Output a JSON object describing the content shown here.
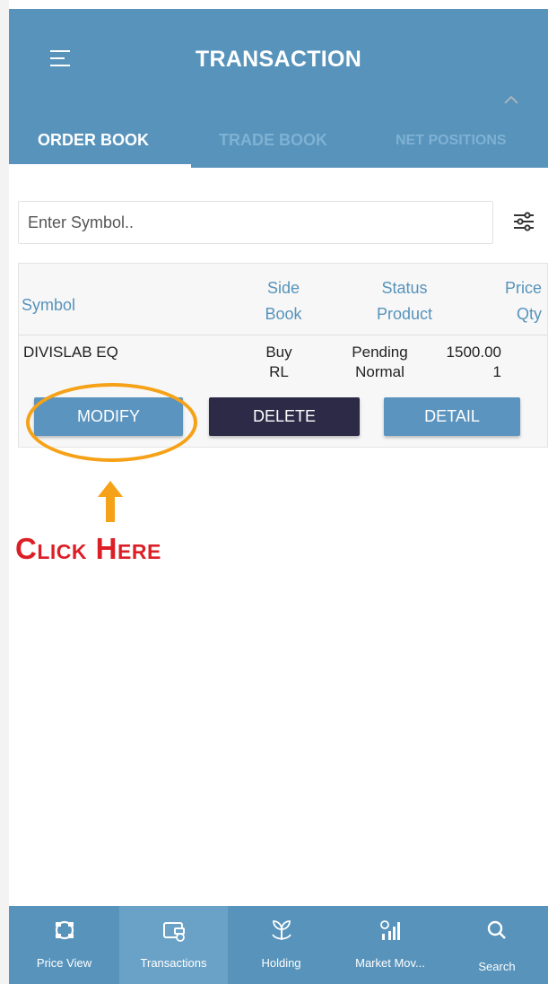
{
  "app_bar": {
    "title": "TRANSACTION",
    "tabs": [
      {
        "label": "ORDER BOOK",
        "active": true
      },
      {
        "label": "TRADE BOOK",
        "active": false
      },
      {
        "label": "NET POSITIONS",
        "active": false
      }
    ]
  },
  "search": {
    "placeholder": "Enter Symbol..",
    "value": ""
  },
  "orders": {
    "headers": {
      "symbol": "Symbol",
      "side": "Side",
      "book": "Book",
      "status": "Status",
      "product": "Product",
      "price": "Price",
      "qty": "Qty"
    },
    "rows": [
      {
        "symbol": "DIVISLAB EQ",
        "side": "Buy",
        "book": "RL",
        "status": "Pending",
        "product": "Normal",
        "price": "1500.00",
        "qty": "1"
      }
    ],
    "actions": {
      "modify": "MODIFY",
      "delete": "DELETE",
      "detail": "DETAIL"
    }
  },
  "annotation": {
    "text": "Click Here",
    "ring_color": "#f5a219",
    "text_color": "#dc1f26"
  },
  "bottom_nav": {
    "items": [
      {
        "label": "Price View",
        "icon": "price-view-icon",
        "active": false
      },
      {
        "label": "Transactions",
        "icon": "wallet-icon",
        "active": true
      },
      {
        "label": "Holding",
        "icon": "holding-plant-icon",
        "active": false
      },
      {
        "label": "Market Mov...",
        "icon": "market-movers-icon",
        "active": false
      },
      {
        "label": "Search",
        "icon": "search-icon",
        "active": false
      }
    ]
  },
  "colors": {
    "primary": "#5793bb",
    "dark_button": "#2d2a48",
    "tab_inactive": "#7fb1d3"
  }
}
